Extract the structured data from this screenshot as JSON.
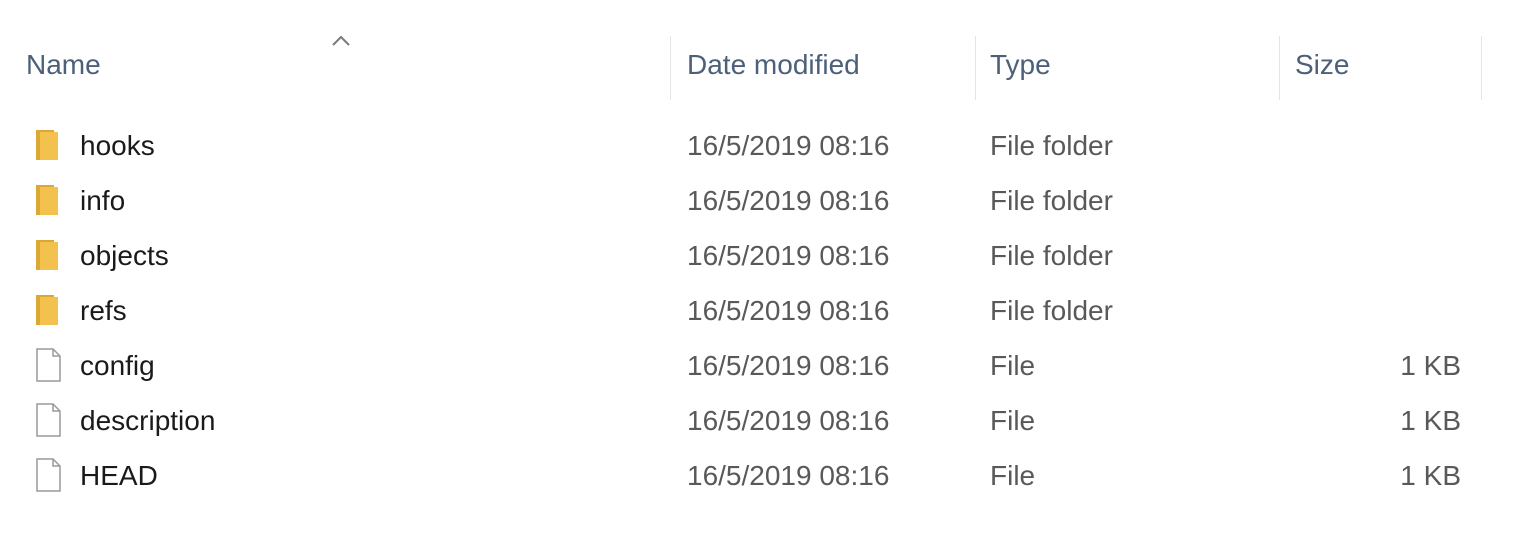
{
  "columns": {
    "name": "Name",
    "date_modified": "Date modified",
    "type": "Type",
    "size": "Size"
  },
  "sort": {
    "column": "name",
    "indicator_icon": "chevron-up-icon"
  },
  "files": [
    {
      "name": "hooks",
      "date": "16/5/2019 08:16",
      "type": "File folder",
      "size": "",
      "icon": "folder-icon"
    },
    {
      "name": "info",
      "date": "16/5/2019 08:16",
      "type": "File folder",
      "size": "",
      "icon": "folder-icon"
    },
    {
      "name": "objects",
      "date": "16/5/2019 08:16",
      "type": "File folder",
      "size": "",
      "icon": "folder-icon"
    },
    {
      "name": "refs",
      "date": "16/5/2019 08:16",
      "type": "File folder",
      "size": "",
      "icon": "folder-icon"
    },
    {
      "name": "config",
      "date": "16/5/2019 08:16",
      "type": "File",
      "size": "1 KB",
      "icon": "file-icon"
    },
    {
      "name": "description",
      "date": "16/5/2019 08:16",
      "type": "File",
      "size": "1 KB",
      "icon": "file-icon"
    },
    {
      "name": "HEAD",
      "date": "16/5/2019 08:16",
      "type": "File",
      "size": "1 KB",
      "icon": "file-icon"
    }
  ],
  "colors": {
    "header_text": "#4c607a",
    "folder_yellow": "#f2c14e",
    "folder_dark": "#dca835",
    "file_outline": "#9a9a9a"
  }
}
